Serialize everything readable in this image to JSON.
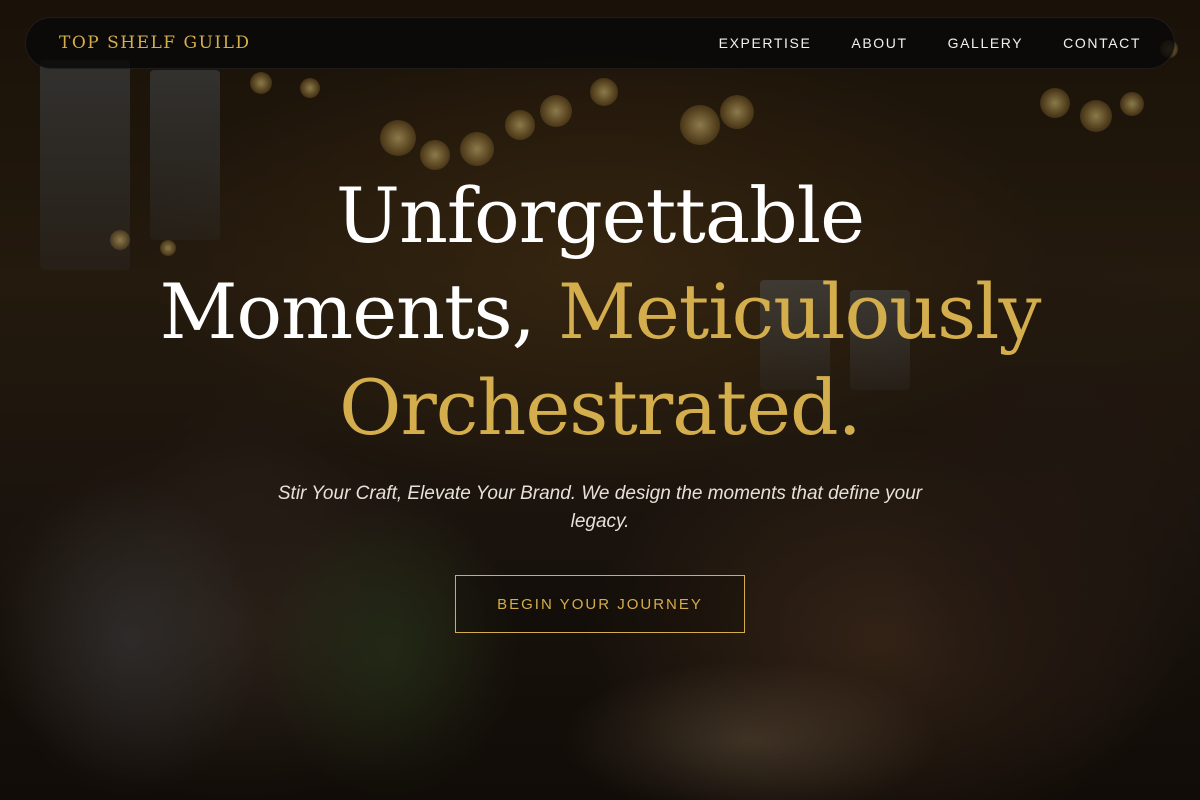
{
  "nav": {
    "logo": "TOP SHELF GUILD",
    "links": [
      {
        "label": "EXPERTISE"
      },
      {
        "label": "ABOUT"
      },
      {
        "label": "GALLERY"
      },
      {
        "label": "CONTACT"
      }
    ]
  },
  "hero": {
    "headline_line1": "Unforgettable",
    "headline_line2_white": "Moments,",
    "headline_line2_accent": "Meticulously",
    "headline_line3_accent": "Orchestrated.",
    "subtitle": "Stir Your Craft, Elevate Your Brand. We design the moments that define your legacy.",
    "cta_label": "BEGIN YOUR JOURNEY",
    "background_image": "celebration-toast-photo"
  },
  "colors": {
    "accent": "#d4ad4c",
    "text": "#ffffff",
    "nav_bg": "#080808"
  }
}
